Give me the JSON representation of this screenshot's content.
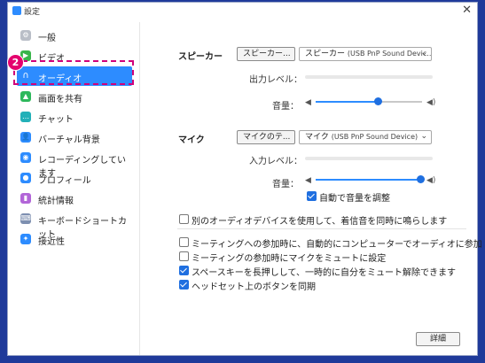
{
  "window": {
    "title": "設定",
    "close_glyph": "✕"
  },
  "badge": "2",
  "sidebar": {
    "items": [
      {
        "label": "一般",
        "icon": "gear-icon",
        "color": "#b9bec7",
        "glyph": "⚙"
      },
      {
        "label": "ビデオ",
        "icon": "video-icon",
        "color": "#39b54a",
        "glyph": "▶"
      },
      {
        "label": "オーディオ",
        "icon": "headphones-icon",
        "color": "#2d8cff",
        "glyph": "∩",
        "active": true
      },
      {
        "label": "画面を共有",
        "icon": "share-screen-icon",
        "color": "#2eb85c",
        "glyph": "▲"
      },
      {
        "label": "チャット",
        "icon": "chat-icon",
        "color": "#22b0b8",
        "glyph": "…"
      },
      {
        "label": "バーチャル背景",
        "icon": "virtual-background-icon",
        "color": "#2d8cff",
        "glyph": "👤"
      },
      {
        "label": "レコーディングしています",
        "icon": "recording-icon",
        "color": "#2d8cff",
        "glyph": "◉"
      },
      {
        "label": "プロフィール",
        "icon": "profile-icon",
        "color": "#2d8cff",
        "glyph": "●"
      },
      {
        "label": "統計情報",
        "icon": "statistics-icon",
        "color": "#b265d8",
        "glyph": "▮"
      },
      {
        "label": "キーボードショートカット",
        "icon": "keyboard-icon",
        "color": "#7d8fb0",
        "glyph": "⌨"
      },
      {
        "label": "接近性",
        "icon": "accessibility-icon",
        "color": "#2d8cff",
        "glyph": "✦"
      }
    ]
  },
  "speaker": {
    "section_label": "スピーカー",
    "test_button": "スピーカー...",
    "device_prefix": "スピーカー",
    "device_name": "(USB PnP Sound Devic...",
    "output_level_label": "出力レベル：",
    "volume_label": "音量：",
    "volume_level": 0.58
  },
  "mic": {
    "section_label": "マイク",
    "test_button": "マイクのテ...",
    "device_prefix": "マイク",
    "device_name": "(USB PnP Sound Device)",
    "input_level_label": "入力レベル：",
    "volume_label": "音量：",
    "volume_level": 1.0,
    "auto_adjust_label": "自動で音量を調整",
    "auto_adjust_checked": true
  },
  "options": [
    {
      "label": "別のオーディオデバイスを使用して、着信音を同時に鳴らします",
      "checked": false
    },
    {
      "label": "ミーティングへの参加時に、自動的にコンピューターでオーディオに参加",
      "checked": false
    },
    {
      "label": "ミーティングの参加時にマイクをミュートに設定",
      "checked": false
    },
    {
      "label": "スペースキーを長押しして、一時的に自分をミュート解除できます",
      "checked": true
    },
    {
      "label": "ヘッドセット上のボタンを同期",
      "checked": true
    }
  ],
  "advanced_button": "詳細",
  "glyphs": {
    "caret": "⌄",
    "speaker_low": "◀",
    "speaker_high": "◀)"
  },
  "accent_color": "#2d8cff"
}
